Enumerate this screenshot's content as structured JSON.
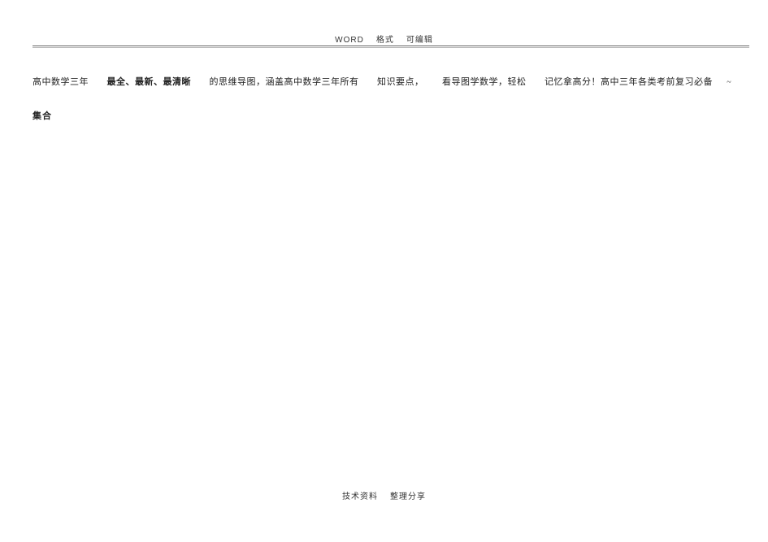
{
  "header": {
    "word_label": "WORD",
    "format_label": "格式",
    "editable_label": "可编辑"
  },
  "content": {
    "intro_p1": "高中数学三年",
    "intro_bold": "最全、最新、最清晰",
    "intro_p2": "的思维导图，涵盖高中数学三年所有",
    "intro_p3": "知识要点，",
    "intro_p4": "看导图学数学，轻松",
    "intro_p5": "记忆拿高分！高中三年各类考前复习必备",
    "tilde": "~",
    "section_title": "集合"
  },
  "footer": {
    "tech_label": "技术资料",
    "share_label": "整理分享"
  }
}
